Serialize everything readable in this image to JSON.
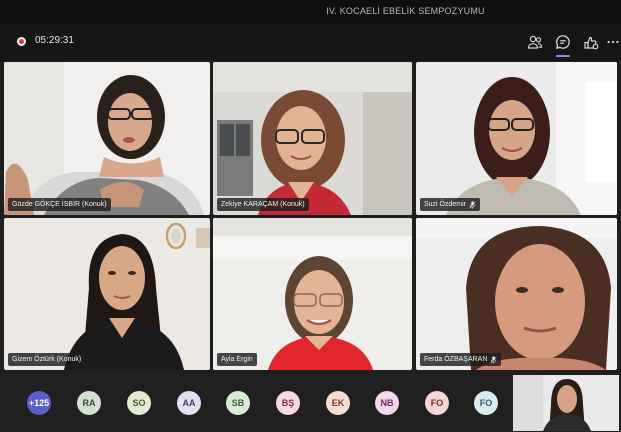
{
  "window": {
    "title": "IV. KOCAELİ EBELİK SEMPOZYUMU"
  },
  "toolbar": {
    "recording_time": "05:29:31",
    "icons": [
      "people-icon",
      "chat-icon",
      "reactions-icon",
      "more-icon"
    ]
  },
  "participants": [
    {
      "name": "Gözde GÖKÇE İSBİR (Konuk)",
      "muted": false
    },
    {
      "name": "Zekiye KARAÇAM (Konuk)",
      "muted": false
    },
    {
      "name": "Suzi Özdemir",
      "muted": true
    },
    {
      "name": "Gizem Öztürk (Konuk)",
      "muted": false
    },
    {
      "name": "Ayla Ergin",
      "muted": false
    },
    {
      "name": "Ferda ÖZBAŞARAN",
      "muted": true
    }
  ],
  "overflow": {
    "more_count": "+125",
    "avatars": [
      {
        "initials": "RA",
        "bg": "#d3e1d0",
        "fg": "#3b4a37"
      },
      {
        "initials": "SO",
        "bg": "#e3ecd1",
        "fg": "#4b5636"
      },
      {
        "initials": "AA",
        "bg": "#e4e0f2",
        "fg": "#48406a"
      },
      {
        "initials": "SB",
        "bg": "#d9ead7",
        "fg": "#3d5a3a"
      },
      {
        "initials": "BŞ",
        "bg": "#f4d9df",
        "fg": "#7a2d40"
      },
      {
        "initials": "EK",
        "bg": "#f6ddd4",
        "fg": "#7d3a27"
      },
      {
        "initials": "NB",
        "bg": "#f1d8ea",
        "fg": "#6e2c5d"
      },
      {
        "initials": "FO",
        "bg": "#f6d6d6",
        "fg": "#7a2a2a"
      },
      {
        "initials": "FO",
        "bg": "#d8ecf0",
        "fg": "#2f5963"
      }
    ]
  },
  "colors": {
    "record": "#e0333a",
    "accent": "#8b8cf0",
    "more_badge": "#5b5fc7"
  }
}
